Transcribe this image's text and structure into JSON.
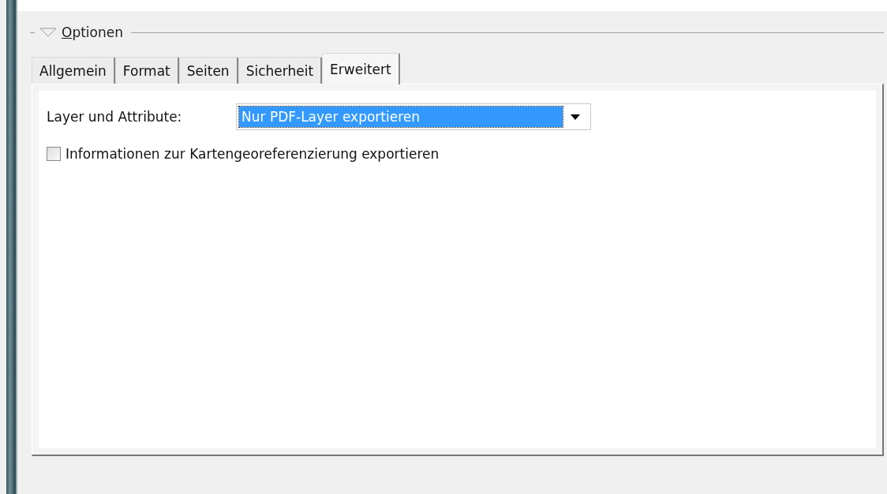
{
  "section": {
    "title": "Optionen",
    "expanded": true
  },
  "tabs": [
    {
      "label": "Allgemein",
      "selected": false
    },
    {
      "label": "Format",
      "selected": false
    },
    {
      "label": "Seiten",
      "selected": false
    },
    {
      "label": "Sicherheit",
      "selected": false
    },
    {
      "label": "Erweitert",
      "selected": true
    }
  ],
  "layer_field": {
    "label": "Layer und Attribute:",
    "value": "Nur PDF-Layer exportieren"
  },
  "georef_checkbox": {
    "label": "Informationen zur Kartengeoreferenzierung exportieren",
    "checked": false
  }
}
